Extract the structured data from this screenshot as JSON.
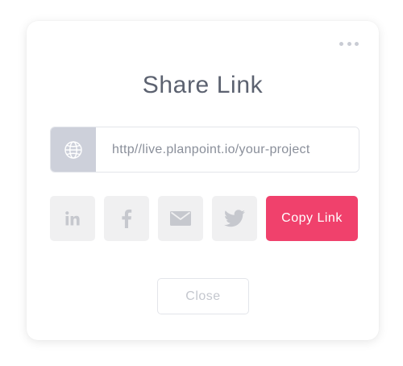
{
  "dialog": {
    "title": "Share Link",
    "menu_icon": "more-horizontal-icon"
  },
  "url": {
    "prefix_icon": "globe-icon",
    "value": "http//live.planpoint.io/your-project"
  },
  "share": {
    "buttons": [
      {
        "name": "linkedin",
        "icon": "linkedin-icon"
      },
      {
        "name": "facebook",
        "icon": "facebook-icon"
      },
      {
        "name": "email",
        "icon": "mail-icon"
      },
      {
        "name": "twitter",
        "icon": "twitter-icon"
      }
    ],
    "copy_label": "Copy Link"
  },
  "footer": {
    "close_label": "Close"
  },
  "colors": {
    "accent": "#f0416c",
    "icon_gray": "#c6c8ce",
    "tile_bg": "#f0f0f1",
    "prefix_bg": "#cdd0da",
    "title_text": "#5c6270"
  }
}
